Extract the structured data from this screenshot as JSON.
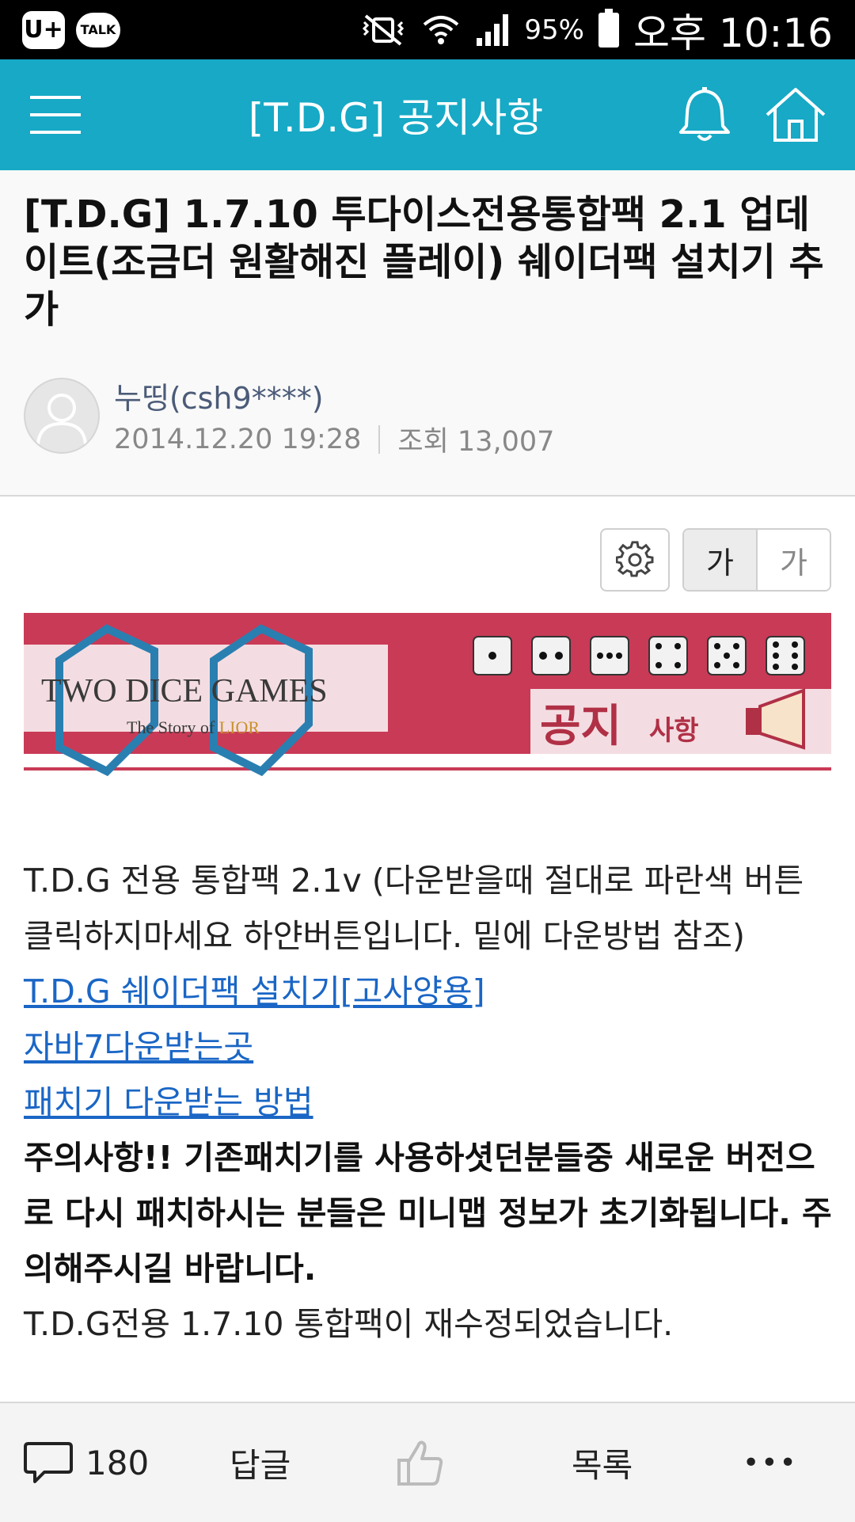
{
  "status_bar": {
    "app_badge": "U+",
    "talk_badge": "TALK",
    "battery": "95%",
    "time": "오후 10:16"
  },
  "app_bar": {
    "title": "[T.D.G] 공지사항"
  },
  "post": {
    "title": "[T.D.G] 1.7.10 투다이스전용통합팩 2.1 업데이트(조금더 원활해진 플레이) 쉐이더팩 설치기 추가",
    "author": "누띵(csh9****)",
    "date": "2014.12.20 19:28",
    "views": "조회 13,007"
  },
  "toolbar": {
    "font_large": "가",
    "font_small": "가"
  },
  "banner": {
    "logo_text": "TWO DICE GAMES",
    "logo_sub_prefix": "The Story of ",
    "logo_sub_name": "LIOR",
    "notice_big": "공지",
    "notice_small": "사항",
    "accent_color": "#c93a56"
  },
  "body": {
    "intro": "T.D.G 전용 통합팩 2.1v (다운받을때 절대로 파란색 버튼 클릭하지마세요 하얀버튼입니다. 밑에 다운방법 참조)",
    "link1": "T.D.G 쉐이더팩 설치기[고사양용]",
    "link2": "자바7다운받는곳",
    "link3": "패치기 다운받는 방법",
    "warning": " 주의사항!! 기존패치기를 사용하셧던분들중 새로운 버전으로 다시 패치하시는 분들은 미니맵 정보가 초기화됩니다. 주의해주시길 바랍니다.",
    "last_line": "T.D.G전용 1.7.10 통합팩이 재수정되었습니다."
  },
  "bottom_bar": {
    "comment_count": "180",
    "reply": "답글",
    "list": "목록",
    "more": "•••"
  },
  "colors": {
    "app_bar": "#17a9c6",
    "link": "#1a66c6"
  }
}
